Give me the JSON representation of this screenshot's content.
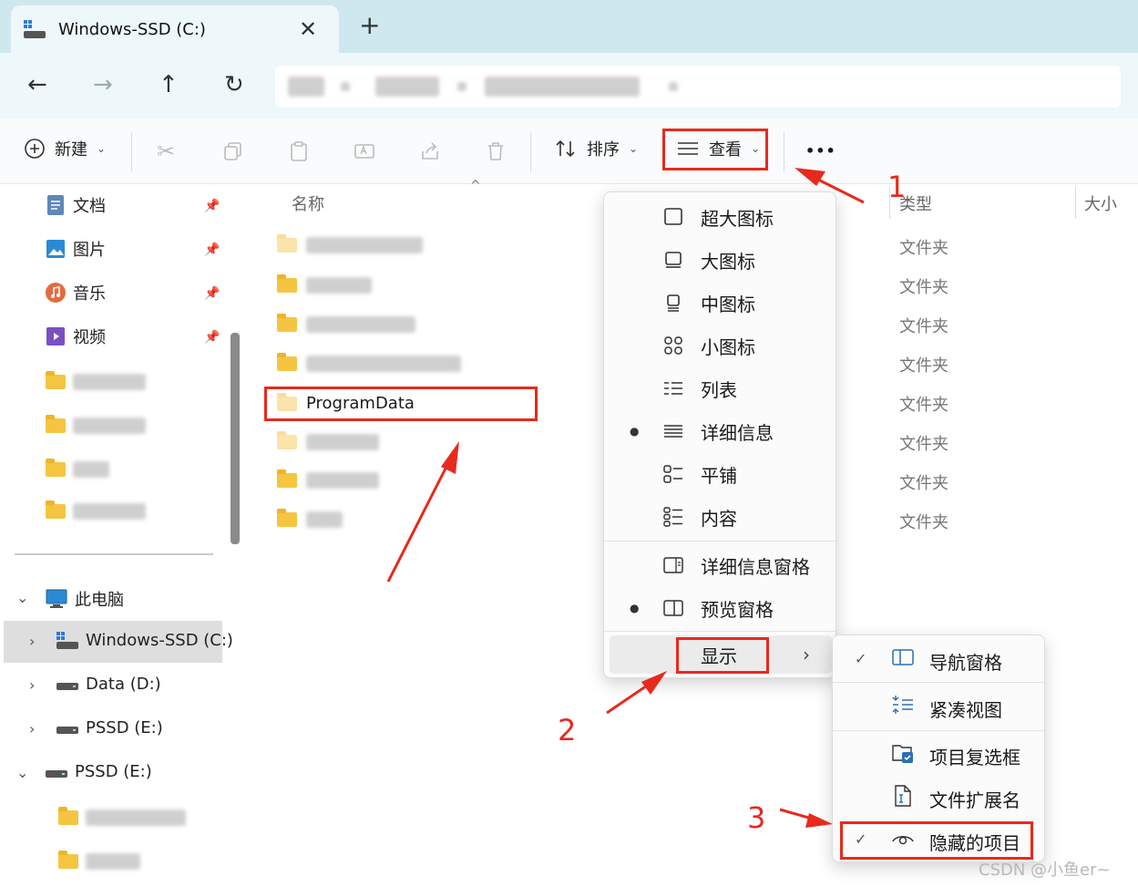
{
  "window": {
    "tab_title": "Windows-SSD (C:)",
    "close_glyph": "✕",
    "new_tab_glyph": "+"
  },
  "nav": {
    "back": "←",
    "forward": "→",
    "up": "↑",
    "refresh": "↻"
  },
  "toolbar": {
    "new_label": "新建",
    "sort_label": "排序",
    "view_label": "查看",
    "more_label": "•••"
  },
  "sidebar": {
    "quick_access": [
      {
        "label": "文档",
        "icon": "documents-icon"
      },
      {
        "label": "图片",
        "icon": "pictures-icon"
      },
      {
        "label": "音乐",
        "icon": "music-icon"
      },
      {
        "label": "视频",
        "icon": "videos-icon"
      }
    ],
    "this_pc": "此电脑",
    "drives": [
      {
        "label": "Windows-SSD (C:)",
        "selected": true
      },
      {
        "label": "Data (D:)",
        "selected": false
      },
      {
        "label": "PSSD (E:)",
        "selected": false
      }
    ],
    "external_drive": "PSSD (E:)"
  },
  "list": {
    "columns": {
      "name": "名称",
      "type": "类型",
      "size": "大小"
    },
    "highlighted_folder": "ProgramData",
    "types": [
      "文件夹",
      "文件夹",
      "文件夹",
      "文件夹",
      "文件夹",
      "文件夹",
      "文件夹",
      "文件夹"
    ]
  },
  "view_menu": {
    "items": [
      {
        "label": "超大图标",
        "icon": "extra-large-icons-icon",
        "selected": false
      },
      {
        "label": "大图标",
        "icon": "large-icons-icon",
        "selected": false
      },
      {
        "label": "中图标",
        "icon": "medium-icons-icon",
        "selected": false
      },
      {
        "label": "小图标",
        "icon": "small-icons-icon",
        "selected": false
      },
      {
        "label": "列表",
        "icon": "list-icon",
        "selected": false
      },
      {
        "label": "详细信息",
        "icon": "details-icon",
        "selected": true
      },
      {
        "label": "平铺",
        "icon": "tiles-icon",
        "selected": false
      },
      {
        "label": "内容",
        "icon": "content-icon",
        "selected": false
      }
    ],
    "panes": [
      {
        "label": "详细信息窗格",
        "icon": "details-pane-icon",
        "selected": false
      },
      {
        "label": "预览窗格",
        "icon": "preview-pane-icon",
        "selected": true
      }
    ],
    "show_label": "显示"
  },
  "show_menu": {
    "items": [
      {
        "label": "导航窗格",
        "icon": "navigation-pane-icon",
        "checked": true
      },
      {
        "label": "紧凑视图",
        "icon": "compact-view-icon",
        "checked": false
      },
      {
        "label": "项目复选框",
        "icon": "item-checkbox-icon",
        "checked": false
      },
      {
        "label": "文件扩展名",
        "icon": "file-extension-icon",
        "checked": false
      },
      {
        "label": "隐藏的项目",
        "icon": "hidden-items-icon",
        "checked": true
      }
    ]
  },
  "annotations": {
    "step1": "1",
    "step2": "2",
    "step3": "3"
  },
  "watermark": "CSDN @小鱼er~",
  "colors": {
    "annotation": "#e8291e",
    "tabbar": "#cfe7ee",
    "folder": "#f5c542"
  }
}
